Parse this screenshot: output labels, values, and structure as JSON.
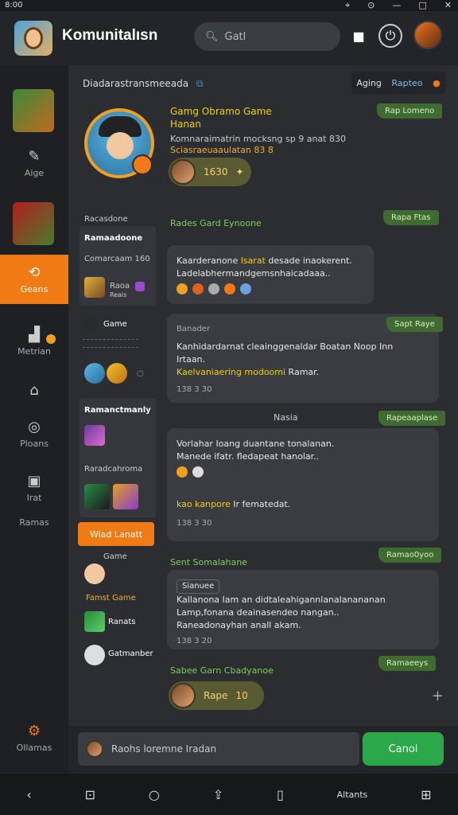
{
  "status": {
    "time": "8:00"
  },
  "header": {
    "title": "Komunitalısn",
    "search_placeholder": "Gatl"
  },
  "sidebar": {
    "items": [
      {
        "label": "Aige",
        "icon": "controller-icon"
      },
      {
        "label": "Geans",
        "icon": "refresh-icon"
      },
      {
        "label": "Metrian",
        "icon": "chart-icon"
      },
      {
        "label": "Ploans",
        "icon": "globe-icon"
      },
      {
        "label": "Irat",
        "icon": "image-icon"
      },
      {
        "label": "Ramas",
        "icon": "none"
      }
    ],
    "footer": "Ollamas"
  },
  "panel": {
    "title": "Diadarastransmeeada",
    "lang_label": "Aging",
    "lang_value": "Rapteo"
  },
  "hero": {
    "name_line1": "Gamg Obramo Game",
    "name_line2": "Hanan",
    "desc_line1": "Komnaraimatrin mocksng sp 9 anat 830",
    "desc_line2": "Sciasraeuaaulatan 83 8",
    "pill_value": "1630",
    "tag": "Rap Lomeno"
  },
  "col_list": {
    "heading": "Racasdone",
    "block1_title": "Ramaadoone",
    "block1_sub": "Comarcaam 160",
    "block1_item": "Raoa",
    "block1_item_sub": "Reais",
    "game_label": "Game",
    "recent_title": "Ramanctmanly",
    "recent_sub": "Raradcahroma",
    "active_button": "Wiad Lanatt",
    "game_row": "Game",
    "fame_label": "Famst Game",
    "last1": "Ranats",
    "last2": "Gatmanber"
  },
  "feed": [
    {
      "head": "Rades Gard Eynoone",
      "tag": "Rapa Ftas",
      "line1": "Kaarderanone ",
      "hl1": "lsarat",
      "line1b": " desade inaokerent.",
      "line2": "Ladelabhermandgemsnhaicadaaa.."
    },
    {
      "sub": "Banader",
      "tag": "Sapt Raye",
      "line1": "Kanhidardarnat cleainggenaldar Boatan Noop Inn",
      "line2": "Irtaan.",
      "hl": "Kaelvaniaering modoomi",
      "hl_tail": " Ramar.",
      "meta": "138 3 30"
    },
    {
      "center": "Nasia",
      "tag": "Rapeaaplase",
      "line1": "Vorlahar Ioang duantane tonalanan.",
      "line2": "Manede ifatr. fledapeat hanolar..",
      "hl": "kao kanpore",
      "hl_tail": " Ir fematedat.",
      "meta": "138 3 30"
    },
    {
      "head": "Sent Somalahane",
      "tag": "Ramao0yoo",
      "chip": "Sianuee",
      "line1": "Kallanona Iam an didtaleahigannlanalanananan",
      "line2": "Lamp,fonana deainasendeo nangan..",
      "line3": "Raneadonayhan anall akam.",
      "meta": "138 3 20"
    },
    {
      "head": "Sabee Garn Cbadyanoe",
      "tag": "Ramaeeys",
      "pill_label": "Rape",
      "pill_value": "10"
    }
  ],
  "composer": {
    "placeholder": "Raohs loremne Iradan",
    "send": "Canol"
  },
  "navbar": {
    "label": "Altants"
  }
}
